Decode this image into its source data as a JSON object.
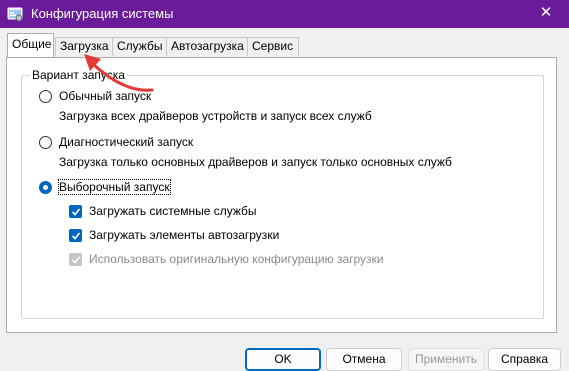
{
  "window": {
    "title": "Конфигурация системы",
    "close_glyph": "✕",
    "title_bar_color": "#6a1b9a",
    "icon": "msconfig-icon"
  },
  "tabs": [
    {
      "label": "Общие",
      "active": true
    },
    {
      "label": "Загрузка",
      "active": false
    },
    {
      "label": "Службы",
      "active": false
    },
    {
      "label": "Автозагрузка",
      "active": false
    },
    {
      "label": "Сервис",
      "active": false
    }
  ],
  "startup_group": {
    "legend": "Вариант запуска",
    "options": [
      {
        "label": "Обычный запуск",
        "description": "Загрузка всех драйверов устройств и запуск всех служб",
        "selected": false
      },
      {
        "label": "Диагностический запуск",
        "description": "Загрузка только основных драйверов и запуск только основных служб",
        "selected": false
      },
      {
        "label": "Выборочный запуск",
        "selected": true
      }
    ],
    "selective_options": [
      {
        "label": "Загружать системные службы",
        "checked": true,
        "enabled": true
      },
      {
        "label": "Загружать элементы автозагрузки",
        "checked": true,
        "enabled": true
      },
      {
        "label": "Использовать оригинальную конфигурацию загрузки",
        "checked": true,
        "enabled": false
      }
    ]
  },
  "buttons": {
    "ok": "OK",
    "cancel": "Отмена",
    "apply": "Применить",
    "help": "Справка"
  },
  "annotation": {
    "arrow_color": "#e53935"
  },
  "accent_color": "#0067c0"
}
